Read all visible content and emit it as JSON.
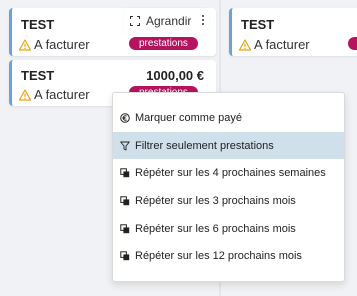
{
  "board": {
    "cards": [
      {
        "title": "TEST",
        "status": "A facturer",
        "badge": "prestations",
        "amount": ""
      },
      {
        "title": "TEST",
        "status": "A facturer",
        "badge": "prestations",
        "amount": "1000,00 €"
      },
      {
        "title": "TEST",
        "status": "A facturer",
        "badge": "",
        "amount": ""
      }
    ],
    "hover_action": {
      "label": "Agrandir",
      "icon": "expand-icon"
    }
  },
  "context_menu": {
    "items": [
      {
        "label": "Marquer comme payé",
        "icon": "euro-icon"
      },
      {
        "label": "Filtrer seulement prestations",
        "icon": "filter-icon"
      },
      {
        "label": "Répéter sur les 4 prochaines semaines",
        "icon": "copy-icon"
      },
      {
        "label": "Répéter sur les 3 prochains mois",
        "icon": "copy-icon"
      },
      {
        "label": "Répéter sur les 6 prochains mois",
        "icon": "copy-icon"
      },
      {
        "label": "Répéter sur les 12 prochains mois",
        "icon": "copy-icon"
      }
    ],
    "active_index": 1
  },
  "colors": {
    "card_border": "#6aa3d8",
    "badge": "#b5135e",
    "warning": "#e8a317",
    "menu_highlight": "#cfe0ea"
  }
}
